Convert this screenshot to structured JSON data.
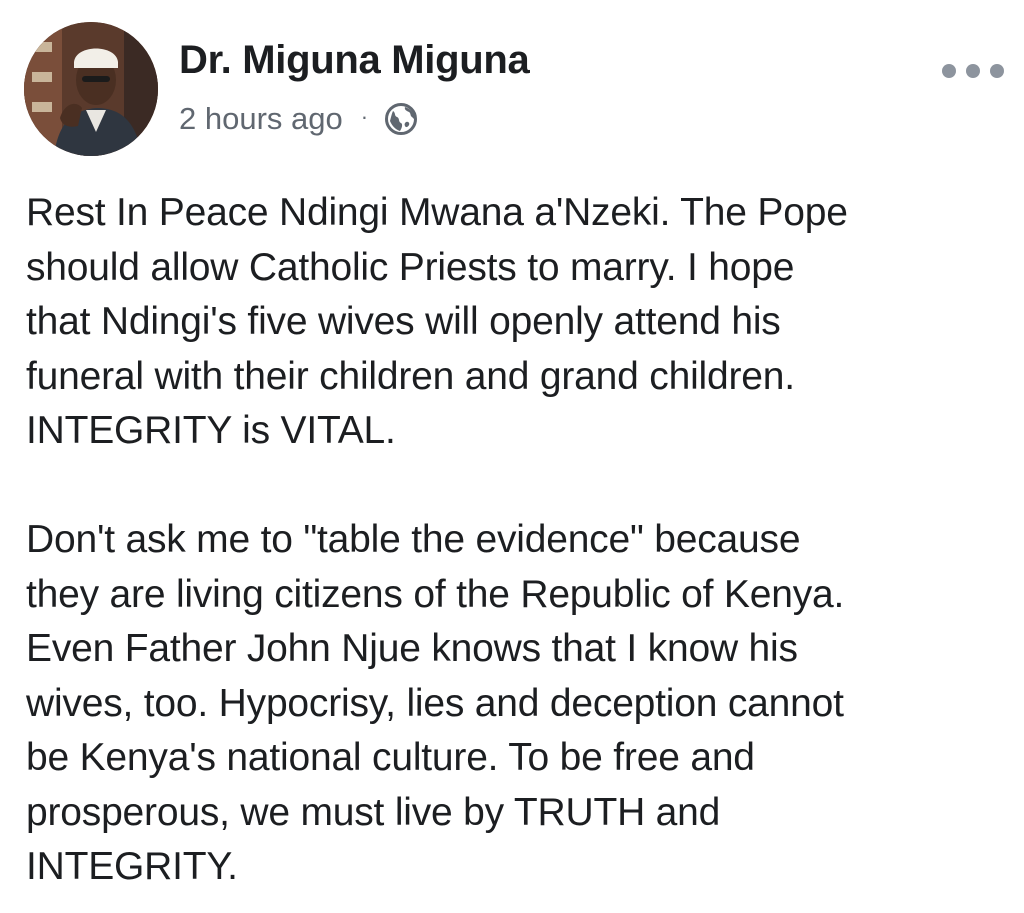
{
  "post": {
    "author": "Dr. Miguna Miguna",
    "timestamp": "2 hours ago",
    "separator": "·",
    "privacy_icon": "globe-icon",
    "more_icon": "more-options-icon",
    "paragraphs": [
      "Rest In Peace Ndingi Mwana a'Nzeki. The Pope\nshould allow Catholic Priests to marry. I hope\nthat Ndingi's five wives will openly attend his\nfuneral with their children and grand children.\nINTEGRITY is VITAL.",
      "Don't ask me to \"table the evidence\" because\nthey are living citizens of the Republic of Kenya.\nEven Father John Njue knows that I know his\nwives, too. Hypocrisy, lies and deception cannot\nbe Kenya's national culture. To be free and\nprosperous, we must live by TRUTH and\nINTEGRITY."
    ]
  },
  "colors": {
    "text": "#1c1e21",
    "meta_text": "#606770",
    "icon_gray": "#8d949e",
    "background": "#ffffff"
  }
}
